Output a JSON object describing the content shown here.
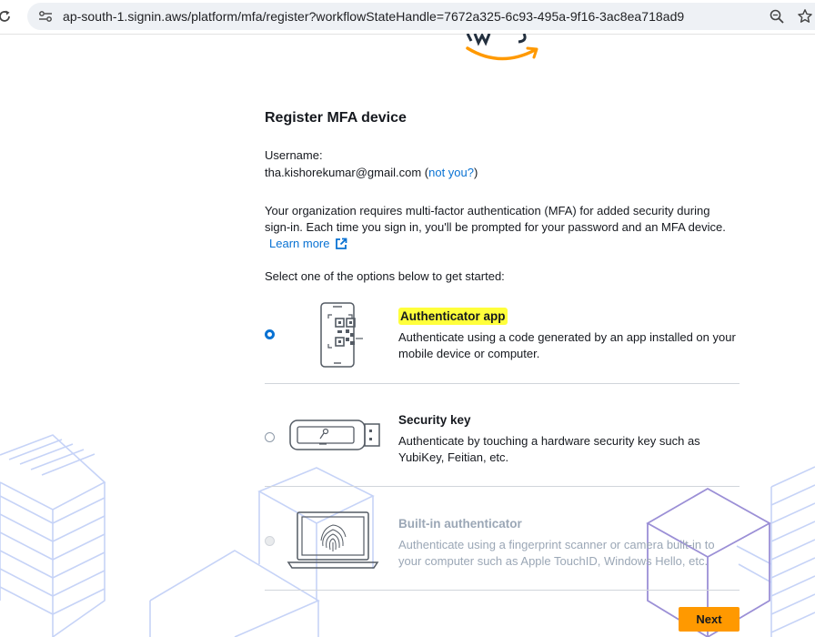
{
  "browser": {
    "url": "ap-south-1.signin.aws/platform/mfa/register?workflowStateHandle=7672a325-6c93-495a-9f16-3ac8ea718ad9"
  },
  "page": {
    "title": "Register MFA device",
    "username_label": "Username:",
    "username": "tha.kishorekumar@gmail.com",
    "not_you_open": " (",
    "not_you_link": "not you?",
    "not_you_close": ")",
    "intro": "Your organization requires multi-factor authentication (MFA) for added security during sign-in. Each time you sign in, you'll be prompted for your password and an MFA device.",
    "learn_more": "Learn more",
    "select_prompt": "Select one of the options below to get started:"
  },
  "options": [
    {
      "title": "Authenticator app",
      "description": "Authenticate using a code generated by an app installed on your mobile device or computer.",
      "selected": true,
      "icon": "phone-qr-icon"
    },
    {
      "title": "Security key",
      "description": "Authenticate by touching a hardware security key such as YubiKey, Feitian, etc.",
      "selected": false,
      "icon": "usb-key-icon"
    },
    {
      "title": "Built-in authenticator",
      "description": "Authenticate using a fingerprint scanner or camera built-in to your computer such as Apple TouchID, Windows Hello, etc.",
      "selected": false,
      "disabled": true,
      "icon": "laptop-fingerprint-icon"
    }
  ],
  "actions": {
    "next_label": "Next"
  },
  "colors": {
    "link": "#0972d3",
    "primary_button": "#ff9900",
    "highlight": "#ffff3b",
    "aws_orange": "#ff9900"
  }
}
